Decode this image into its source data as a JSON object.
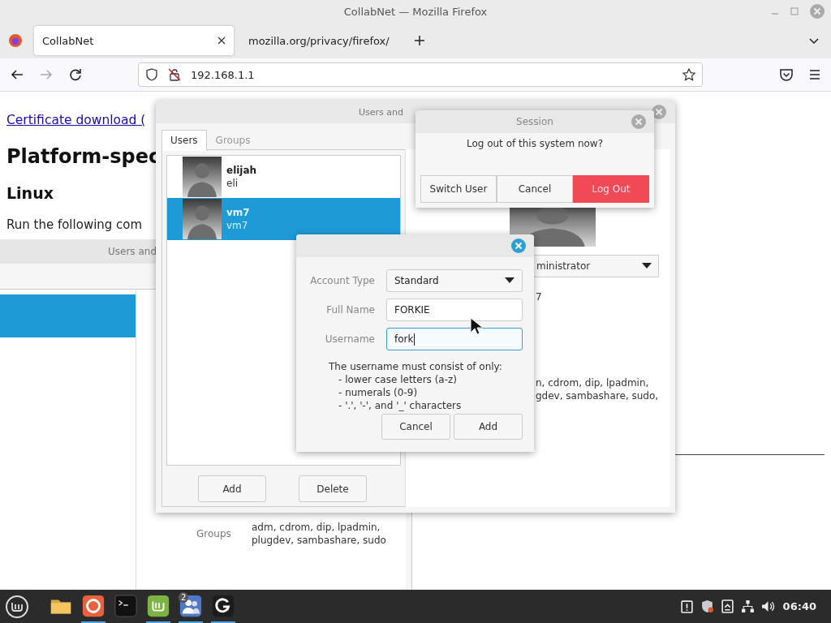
{
  "window": {
    "title": "CollabNet — Mozilla Firefox"
  },
  "tabs": [
    {
      "label": "CollabNet",
      "selected": true,
      "kind": "page"
    },
    {
      "label": "mozilla.org/privacy/firefox/",
      "selected": false,
      "kind": "warning"
    }
  ],
  "address_bar": {
    "value": "192.168.1.1"
  },
  "page": {
    "link": "Certificate download (",
    "heading": "Platform-spec",
    "subheading": "Linux",
    "paragraph": "Run the following com"
  },
  "background_window": {
    "title": "Users and",
    "groups_label": "Groups",
    "groups_value": "adm, cdrom, dip, lpadmin, plugdev, sambashare, sudo"
  },
  "users_window": {
    "title": "Users and",
    "tabs": [
      {
        "label": "Users",
        "selected": true
      },
      {
        "label": "Groups",
        "selected": false
      }
    ],
    "users": [
      {
        "name": "elijah",
        "login": "eli",
        "selected": false
      },
      {
        "name": "vm7",
        "login": "vm7",
        "selected": true
      }
    ],
    "account_type": "ministrator",
    "detail": "7",
    "groups_lines": [
      "n, cdrom, dip, lpadmin,",
      "gdev, sambashare, sudo,"
    ],
    "buttons": [
      "Add",
      "Delete"
    ]
  },
  "session_dialog": {
    "title": "Session",
    "message": "Log out of this system now?",
    "buttons": [
      {
        "label": "Switch User",
        "kind": "normal"
      },
      {
        "label": "Cancel",
        "kind": "normal"
      },
      {
        "label": "Log Out",
        "kind": "destructive"
      }
    ]
  },
  "add_user_dialog": {
    "fields": [
      {
        "label": "Account Type",
        "kind": "dropdown",
        "value": "Standard",
        "focused": false
      },
      {
        "label": "Full Name",
        "kind": "text",
        "value": "FORKIE",
        "focused": false
      },
      {
        "label": "Username",
        "kind": "text",
        "value": "fork",
        "focused": true
      }
    ],
    "hint": "The username must consist of only:",
    "rules": [
      "- lower case letters (a-z)",
      "- numerals (0-9)",
      "- '.', '-', and '_' characters"
    ],
    "buttons": [
      "Cancel",
      "Add"
    ]
  },
  "taskbar": {
    "apps": [
      {
        "kind": "files",
        "running": false
      },
      {
        "kind": "firefox",
        "running": true
      },
      {
        "kind": "terminal",
        "running": false
      },
      {
        "kind": "mint",
        "running": true
      },
      {
        "kind": "users",
        "running": true,
        "badge": "2"
      },
      {
        "kind": "refresh",
        "running": true
      }
    ],
    "clock": "06:40"
  }
}
